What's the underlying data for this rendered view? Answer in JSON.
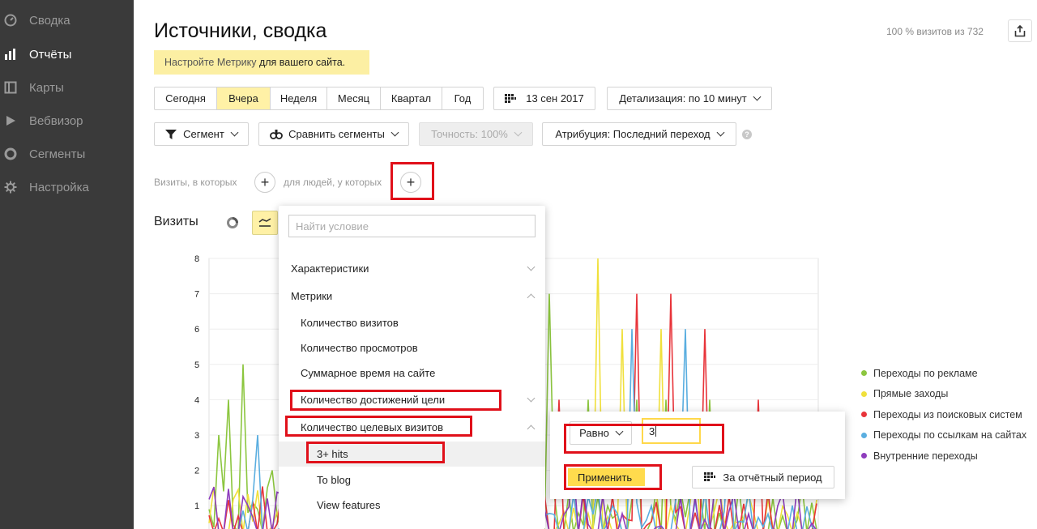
{
  "sidebar": {
    "items": [
      {
        "label": "Сводка",
        "icon": "speedometer-icon"
      },
      {
        "label": "Отчёты",
        "icon": "bar-chart-icon"
      },
      {
        "label": "Карты",
        "icon": "map-icon"
      },
      {
        "label": "Вебвизор",
        "icon": "play-icon"
      },
      {
        "label": "Сегменты",
        "icon": "pie-icon"
      },
      {
        "label": "Настройка",
        "icon": "gear-icon"
      }
    ]
  },
  "header": {
    "title": "Источники, сводка",
    "visits_info": "100 % визитов из 732"
  },
  "notice": {
    "text": "Настройте Метрику ",
    "link": "для вашего сайта."
  },
  "periods": [
    "Сегодня",
    "Вчера",
    "Неделя",
    "Месяц",
    "Квартал",
    "Год"
  ],
  "selected_period": "Вчера",
  "date_label": "13 сен 2017",
  "detail_label": "Детализация: по 10 минут",
  "segment_label": "Сегмент",
  "compare_label": "Сравнить сегменты",
  "accuracy_label": "Точность: 100%",
  "attribution_label": "Атрибуция: Последний переход",
  "filters": {
    "visits_text": "Визиты, в которых",
    "people_text": "для людей, у которых"
  },
  "visits_heading": "Визиты",
  "dropdown": {
    "search_placeholder": "Найти условие",
    "groups": [
      {
        "label": "Характеристики"
      },
      {
        "label": "Метрики"
      }
    ],
    "items": [
      "Количество визитов",
      "Количество просмотров",
      "Суммарное время на сайте",
      "Количество достижений цели",
      "Количество целевых визитов"
    ],
    "subitems": [
      "3+ hits",
      "To blog",
      "View features"
    ]
  },
  "condition": {
    "operator": "Равно",
    "value": "3",
    "apply_label": "Применить",
    "period_label": "За отчётный период"
  },
  "chart_data": {
    "type": "line",
    "y_ticks": [
      "8",
      "7",
      "6",
      "5",
      "4",
      "3",
      "2",
      "1"
    ],
    "ylim": [
      0,
      8
    ],
    "series": [
      {
        "name": "Переходы по рекламе",
        "color": "#8cc63f"
      },
      {
        "name": "Прямые заходы",
        "color": "#f0e03c"
      },
      {
        "name": "Переходы из поисковых систем",
        "color": "#e8343a"
      },
      {
        "name": "Переходы по ссылкам на сайтах",
        "color": "#5aaee0"
      },
      {
        "name": "Внутренние переходы",
        "color": "#8e3dbd"
      }
    ]
  }
}
